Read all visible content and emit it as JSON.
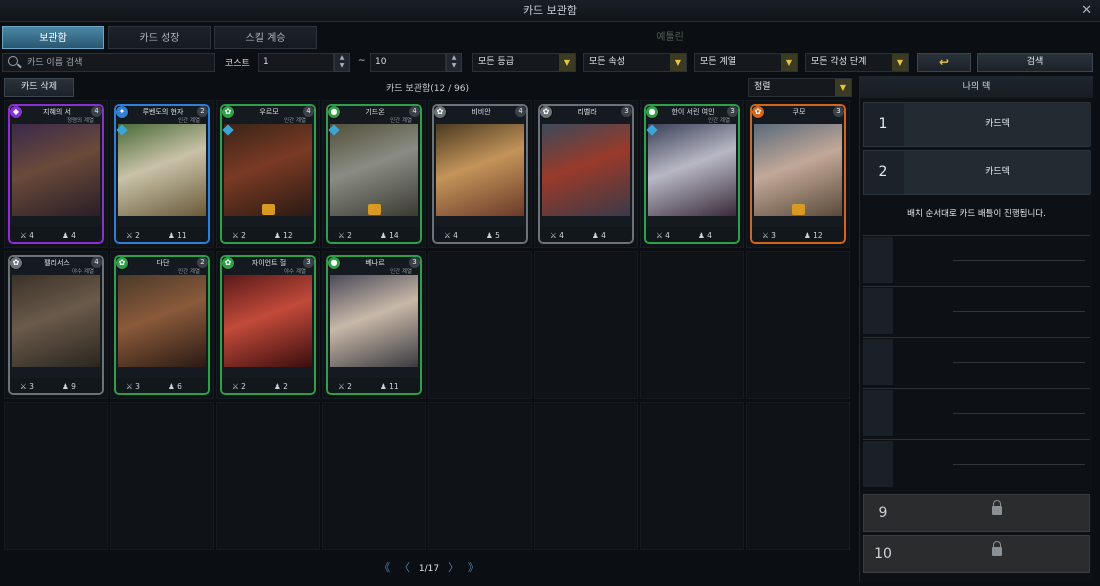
{
  "window": {
    "title": "카드 보관함",
    "close_label": "✕"
  },
  "tabs": [
    {
      "label": "보관함",
      "active": true
    },
    {
      "label": "카드 성장"
    },
    {
      "label": "스킬 계승"
    },
    {
      "label": "예툴린"
    }
  ],
  "filters": {
    "search_placeholder": "카드 이름 검색",
    "cost_label": "코스트",
    "cost_min": "1",
    "range_sep": "~",
    "cost_max": "10",
    "grade": "모든 등급",
    "attribute": "모든 속성",
    "lineage": "모든 계열",
    "awakening": "모든 각성 단계",
    "reset_icon": "↩",
    "search_button": "검색"
  },
  "collection": {
    "delete_button": "카드 삭제",
    "count_label": "카드 보관함(12 / 96)",
    "sort_label": "정렬"
  },
  "cards": [
    {
      "name": "지혜의 서",
      "sub": "정령의 계열",
      "cost": "4",
      "atk": "4",
      "hp": "4",
      "frame": "#8b2fd0",
      "attr": "◆",
      "art": "linear-gradient(160deg,#3a2a4a,#6a4a3a 45%,#2a1e28)",
      "gem": false,
      "awake": false
    },
    {
      "name": "루벤도의 현자",
      "sub": "인간 계열",
      "cost": "2",
      "atk": "2",
      "hp": "11",
      "frame": "#2f7fd6",
      "attr": "✦",
      "art": "linear-gradient(160deg,#4a6a38,#c9c2a8 45%,#6a5a3a)",
      "gem": true,
      "awake": false
    },
    {
      "name": "우르모",
      "sub": "인간 계열",
      "cost": "4",
      "atk": "2",
      "hp": "12",
      "frame": "#2ea04a",
      "attr": "✿",
      "art": "linear-gradient(160deg,#3a2418,#7a3a24 45%,#2a1a14)",
      "gem": true,
      "awake": true
    },
    {
      "name": "기드온",
      "sub": "인간 계열",
      "cost": "4",
      "atk": "2",
      "hp": "14",
      "frame": "#2ea04a",
      "attr": "●",
      "art": "linear-gradient(160deg,#52503a,#8a8c84 45%,#3a3a30)",
      "gem": true,
      "awake": true
    },
    {
      "name": "비비안",
      "sub": "",
      "cost": "4",
      "atk": "4",
      "hp": "5",
      "frame": "#6c7378",
      "attr": "✿",
      "art": "linear-gradient(160deg,#4a3a20,#c4945a 45%,#6a3a2a)",
      "gem": false,
      "awake": false
    },
    {
      "name": "리벨라",
      "sub": "",
      "cost": "3",
      "atk": "4",
      "hp": "4",
      "frame": "#6c7378",
      "attr": "✿",
      "art": "linear-gradient(160deg,#3a4a5a,#9a3a2a 45%,#3a3a48)",
      "gem": false,
      "awake": false
    },
    {
      "name": "한이 서린 여인",
      "sub": "인간 계열",
      "cost": "3",
      "atk": "4",
      "hp": "4",
      "frame": "#2ea04a",
      "attr": "●",
      "art": "linear-gradient(160deg,#3a4058,#b8b8c4 45%,#3a2a3a)",
      "gem": true,
      "awake": false
    },
    {
      "name": "쿠모",
      "sub": "",
      "cost": "3",
      "atk": "3",
      "hp": "12",
      "frame": "#d2661c",
      "attr": "✿",
      "art": "linear-gradient(160deg,#5a6a7a,#c2a898 45%,#5a4a3a)",
      "gem": false,
      "awake": true
    },
    {
      "name": "펠리서스",
      "sub": "야수 계열",
      "cost": "4",
      "atk": "3",
      "hp": "9",
      "frame": "#6c7378",
      "attr": "✿",
      "art": "linear-gradient(160deg,#3a3228,#6a5a4a 45%,#2a2620)",
      "gem": false,
      "awake": false
    },
    {
      "name": "다단",
      "sub": "인간 계열",
      "cost": "2",
      "atk": "3",
      "hp": "6",
      "frame": "#2ea04a",
      "attr": "✿",
      "art": "linear-gradient(160deg,#4a3a2a,#8a5a3a 45%,#2a1a14)",
      "gem": false,
      "awake": false
    },
    {
      "name": "자이언트 헐",
      "sub": "야수 계열",
      "cost": "3",
      "atk": "2",
      "hp": "2",
      "frame": "#2ea04a",
      "attr": "✿",
      "art": "linear-gradient(160deg,#5a1a1a,#c24a3a 45%,#3a0e0e)",
      "gem": false,
      "awake": false
    },
    {
      "name": "베나르",
      "sub": "인간 계열",
      "cost": "3",
      "atk": "2",
      "hp": "11",
      "frame": "#2ea04a",
      "attr": "●",
      "art": "linear-gradient(160deg,#4a4a58,#c8b8a8 45%,#3a3a40)",
      "gem": false,
      "awake": false
    }
  ],
  "pager": {
    "first": "《",
    "prev": "〈",
    "current": "1/17",
    "next": "〉",
    "last": "》"
  },
  "deck": {
    "title": "나의 덱",
    "decks": [
      {
        "num": "1",
        "label": "카드덱"
      },
      {
        "num": "2",
        "label": "카드덱"
      }
    ],
    "info": "배치 순서대로 카드 배틀이 진행됩니다.",
    "locked": [
      {
        "num": "9"
      },
      {
        "num": "10"
      }
    ]
  }
}
